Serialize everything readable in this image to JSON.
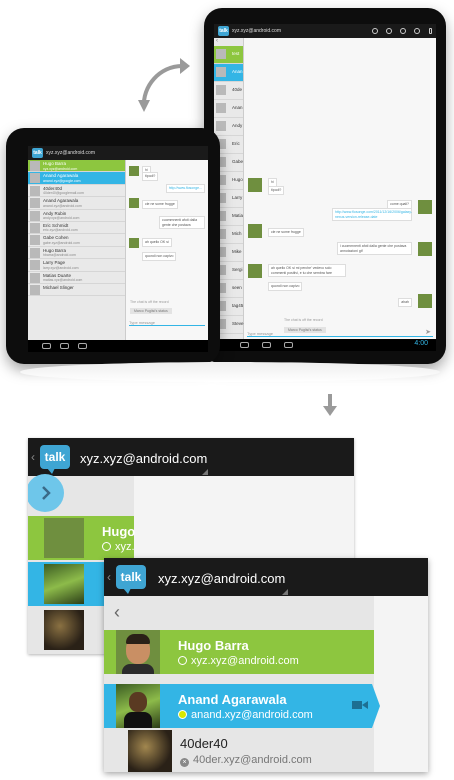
{
  "colors": {
    "accent_blue": "#33b5e5",
    "accent_green": "#8dc63f",
    "action_bar": "#1a1a1a",
    "logo_blue": "#3fa5d3"
  },
  "app": {
    "logo_text": "talk",
    "account": "xyz.xyz@android.com",
    "account_alt": "xyz.xyz@android.com"
  },
  "small_tablet": {
    "account": "xyz.xyz@android.com",
    "contacts": [
      {
        "name": "Hugo Barra",
        "status": "xyz.xyz@android.com",
        "style": "green"
      },
      {
        "name": "Anand Agarawala",
        "status": "anand.xyz@google.com",
        "style": "blue"
      },
      {
        "name": "40der40d",
        "status": "40der40@googlemail.com",
        "style": ""
      },
      {
        "name": "Anand Agarawala",
        "status": "anand.xyz@android.com",
        "style": ""
      },
      {
        "name": "Andy Rubin",
        "status": "andy.xyz@android.com",
        "style": ""
      },
      {
        "name": "Eric Schmidt",
        "status": "eric.xyz@android.com",
        "style": ""
      },
      {
        "name": "Gabe Cohen",
        "status": "gabe.xyz@android.com",
        "style": ""
      },
      {
        "name": "Hugo Barra",
        "status": "hbarra@android.com",
        "style": ""
      },
      {
        "name": "Larry Page",
        "status": "larry.xyz@android.com",
        "style": ""
      },
      {
        "name": "Matias Duarte",
        "status": "matias.xyz@android.com",
        "style": ""
      },
      {
        "name": "Michael Slinger",
        "status": "",
        "style": ""
      }
    ],
    "messages": [
      {
        "text": "hi",
        "side": "left"
      },
      {
        "text": "tipodi?",
        "side": "left"
      },
      {
        "text": "http://www.flosonge...",
        "side": "right"
      },
      {
        "text": "cle ne some frugge",
        "side": "left"
      },
      {
        "text": "cuommnenti afoti dalla gente che postava",
        "side": "right"
      },
      {
        "text": "ah quello OK si",
        "side": "left"
      },
      {
        "text": "quondi non capivo",
        "side": "left"
      }
    ],
    "off_record": "The chat is off the record",
    "pill": "Marco Puglisi's status",
    "type_placeholder": "Type message"
  },
  "large_tablet": {
    "account": "xyz.xyz@android.com",
    "contacts": [
      {
        "name": "test",
        "style": "green"
      },
      {
        "name": "Anan",
        "style": "blue"
      },
      {
        "name": "40de",
        "style": ""
      },
      {
        "name": "Anan",
        "style": ""
      },
      {
        "name": "Andy",
        "style": ""
      },
      {
        "name": "Eric",
        "style": ""
      },
      {
        "name": "Gabe",
        "style": ""
      },
      {
        "name": "Hugo",
        "style": ""
      },
      {
        "name": "Larry",
        "style": ""
      },
      {
        "name": "Matia",
        "style": ""
      },
      {
        "name": "Mich",
        "style": ""
      },
      {
        "name": "Mike",
        "style": ""
      },
      {
        "name": "Sergi",
        "style": ""
      },
      {
        "name": "seen",
        "style": ""
      },
      {
        "name": "tag45",
        "style": ""
      },
      {
        "name": "Steve",
        "style": ""
      }
    ],
    "messages": [
      {
        "text": "hi",
        "side": "left"
      },
      {
        "text": "tipodi?",
        "side": "left"
      },
      {
        "text": "come quali?",
        "side": "right"
      },
      {
        "text": "http://www.flosonge.com/2011/12/16/2006/galaxy-nexus-version-release-date",
        "side": "right"
      },
      {
        "text": "cle ne some frugge",
        "side": "left"
      },
      {
        "text": "i cuommnenti afoti dalla gente che postava annotazioni gif",
        "side": "right"
      },
      {
        "text": "ah quello OK si mi perche' vedevo solo commenti positivi, e tu che sembra fare",
        "side": "left"
      },
      {
        "text": "quondi non capivo",
        "side": "left"
      },
      {
        "text": "ahah",
        "side": "right"
      }
    ],
    "off_record": "The chat is off the record",
    "pill": "Marco Puglisi's status",
    "type_placeholder": "Type message",
    "clock": "4:00"
  },
  "zoom_back": {
    "account": "xyz.xyz@android.com",
    "contacts": [
      {
        "name": "Hugo",
        "status": "xyz."
      }
    ]
  },
  "zoom_front": {
    "account": "xyz.xyz@android.com",
    "contacts": [
      {
        "name": "Hugo Barra",
        "status": "xyz.xyz@android.com"
      },
      {
        "name": "Anand Agarawala",
        "status": "anand.xyz@android.com"
      },
      {
        "name": "40der40",
        "status": "40der.xyz@android.com"
      }
    ]
  }
}
